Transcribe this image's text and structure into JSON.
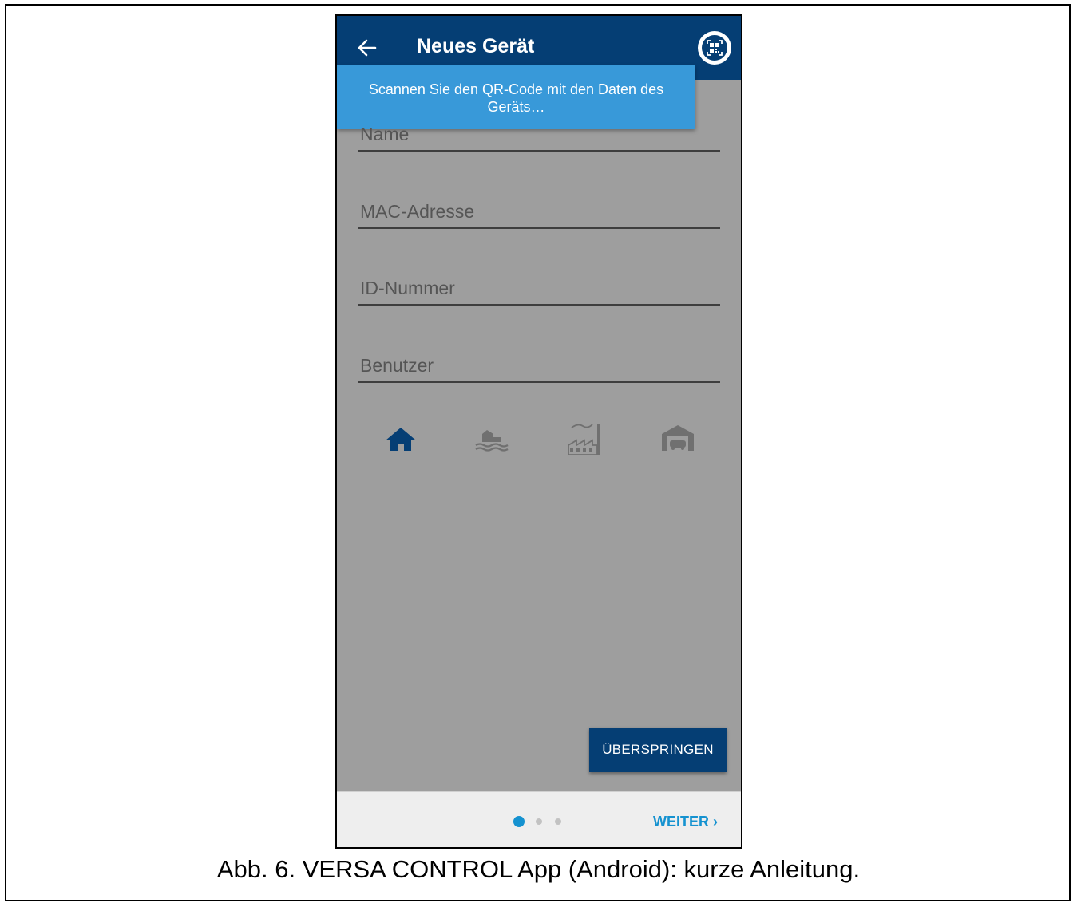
{
  "appbar": {
    "title": "Neues Gerät",
    "back_icon": "arrow-left-icon",
    "qr_icon": "qr-code-icon",
    "background": "#053e74"
  },
  "toast": {
    "message": "Scannen Sie den QR-Code mit den Daten des Geräts…",
    "background": "#3899d9"
  },
  "form": {
    "fields": [
      {
        "placeholder": "Name"
      },
      {
        "placeholder": "MAC-Adresse"
      },
      {
        "placeholder": "ID-Nummer"
      },
      {
        "placeholder": "Benutzer"
      }
    ]
  },
  "object_types": [
    {
      "icon": "house-icon",
      "selected": true
    },
    {
      "icon": "lake-house-icon",
      "selected": false
    },
    {
      "icon": "factory-icon",
      "selected": false
    },
    {
      "icon": "garage-icon",
      "selected": false
    }
  ],
  "actions": {
    "skip_label": "ÜBERSPRINGEN",
    "next_label": "WEITER ›"
  },
  "pager": {
    "total": 3,
    "current": 1,
    "active_color": "#1592d0",
    "inactive_color": "#c2c2c2"
  },
  "caption": "Abb. 6. VERSA CONTROL App (Android): kurze Anleitung."
}
